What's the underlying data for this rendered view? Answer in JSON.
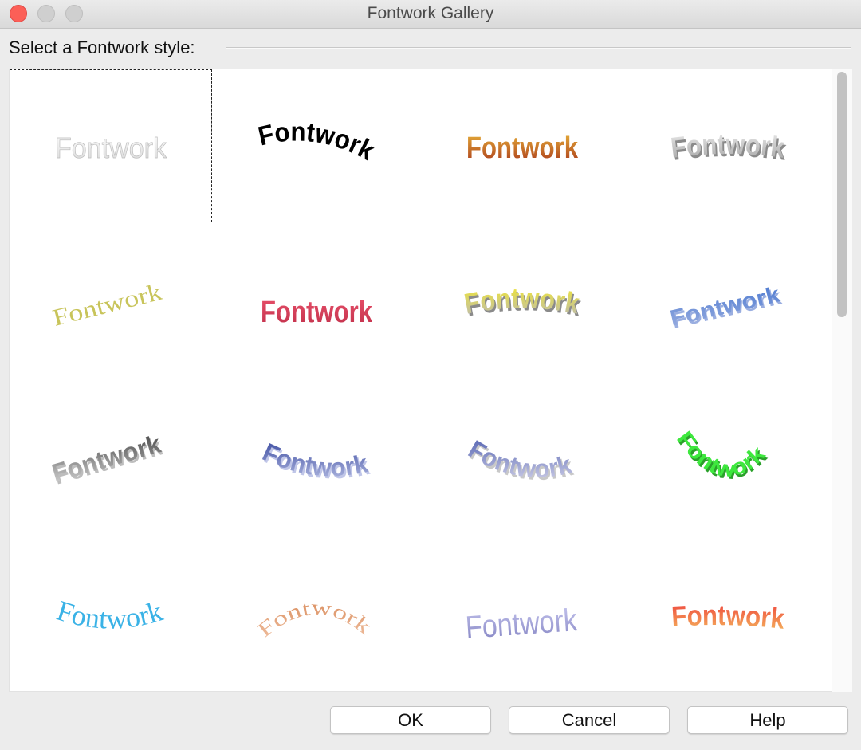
{
  "window": {
    "title": "Fontwork Gallery",
    "close_color": "#fc5f57"
  },
  "dialog": {
    "section_label": "Select a Fontwork style:",
    "selected_index": 0
  },
  "gallery": {
    "styles": [
      {
        "text": "Fontwork",
        "colors": [
          "#ffffff",
          "#d8d8d8"
        ],
        "effect": "outline-white"
      },
      {
        "text": "Fontwork",
        "colors": [
          "#000000",
          "#000000"
        ],
        "effect": "arch-bold"
      },
      {
        "text": "Fontwork",
        "colors": [
          "#e8b23a",
          "#a8361a"
        ],
        "effect": "gold-gradient"
      },
      {
        "text": "Fontwork",
        "colors": [
          "#f2f2f2",
          "#a0a0a0"
        ],
        "effect": "silver-3d"
      },
      {
        "text": "Fontwork",
        "colors": [
          "#c8c45a",
          "#c8c45a"
        ],
        "effect": "slant-serif"
      },
      {
        "text": "Fontwork",
        "colors": [
          "#e8506a",
          "#c0304a"
        ],
        "effect": "fan-perspective"
      },
      {
        "text": "Fontwork",
        "colors": [
          "#f5ea2a",
          "#b8b8b8"
        ],
        "effect": "yellow-3d"
      },
      {
        "text": "Fontwork",
        "colors": [
          "#4a78d0",
          "#9aaee0"
        ],
        "effect": "blue-rise"
      },
      {
        "text": "Fontwork",
        "colors": [
          "#404040",
          "#d8d8d8"
        ],
        "effect": "grey-3d-slant"
      },
      {
        "text": "Fontwork",
        "colors": [
          "#3a4aa0",
          "#b0b8e0"
        ],
        "effect": "blue-wave"
      },
      {
        "text": "Fontwork",
        "colors": [
          "#5060b0",
          "#d0d0e8"
        ],
        "effect": "chrome-wave"
      },
      {
        "text": "Fontwork",
        "colors": [
          "#3ee83e",
          "#3ee83e"
        ],
        "effect": "green-arc-down"
      },
      {
        "text": "Fontwork",
        "colors": [
          "#3ab2e6",
          "#3ab2e6"
        ],
        "effect": "cyan-flag"
      },
      {
        "text": "Fontwork",
        "colors": [
          "#d88a5a",
          "#f0c0a0"
        ],
        "effect": "orange-arc-up"
      },
      {
        "text": "Fontwork",
        "colors": [
          "#c8c8f0",
          "#8080c0"
        ],
        "effect": "lavender-perspective"
      },
      {
        "text": "Fontwork",
        "colors": [
          "#ee3a3a",
          "#f5c060"
        ],
        "effect": "red-orange-gradient"
      }
    ]
  },
  "buttons": {
    "ok": "OK",
    "cancel": "Cancel",
    "help": "Help"
  }
}
